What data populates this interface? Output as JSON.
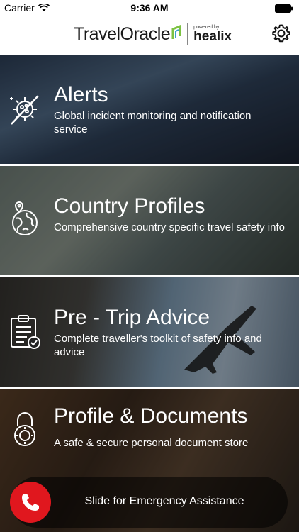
{
  "status": {
    "carrier": "Carrier",
    "time": "9:36 AM"
  },
  "header": {
    "brand_travel": "Travel",
    "brand_oracle": "Oracle",
    "powered_by": "powered by",
    "partner": "healix"
  },
  "tiles": [
    {
      "title": "Alerts",
      "description": "Global incident monitoring and notification service",
      "icon": "alert-virus-icon"
    },
    {
      "title": "Country Profiles",
      "description": "Comprehensive country specific travel safety info",
      "icon": "globe-pin-icon"
    },
    {
      "title": "Pre - Trip Advice",
      "description": "Complete traveller's toolkit of safety info and advice",
      "icon": "clipboard-check-icon"
    },
    {
      "title": "Profile & Documents",
      "description": "A safe & secure personal document store",
      "icon": "padlock-icon"
    }
  ],
  "emergency": {
    "label": "Slide for Emergency Assistance",
    "icon": "phone-icon",
    "accent": "#e0171e"
  }
}
